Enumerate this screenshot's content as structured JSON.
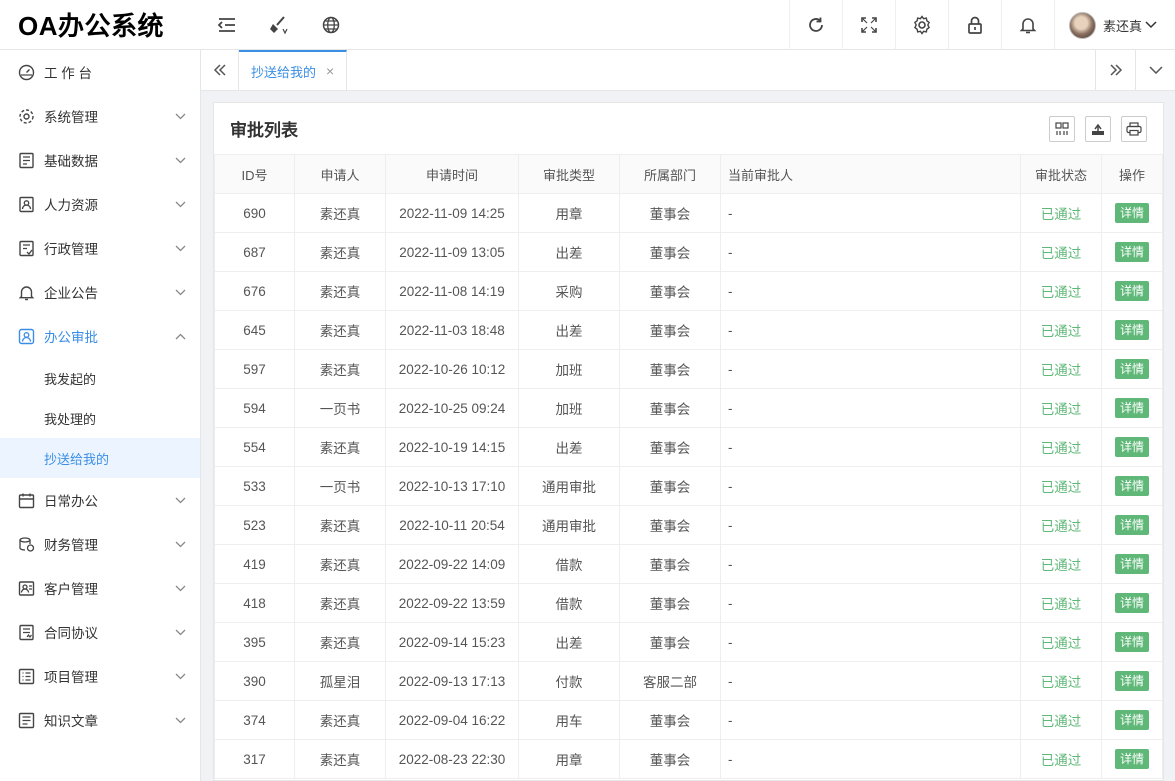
{
  "app": {
    "title": "OA办公系统"
  },
  "topbar": {
    "left_icons": [
      "menu-fold-icon",
      "clear-cache-icon",
      "globe-icon"
    ],
    "right_icons": [
      "refresh-icon",
      "fullscreen-icon",
      "settings-gear-icon",
      "lock-icon",
      "bell-icon"
    ],
    "user_name": "素还真"
  },
  "sidebar": {
    "items": [
      {
        "label": "工 作 台",
        "icon": "dashboard-icon"
      },
      {
        "label": "系统管理",
        "icon": "system-settings-icon"
      },
      {
        "label": "基础数据",
        "icon": "data-icon"
      },
      {
        "label": "人力资源",
        "icon": "hr-icon"
      },
      {
        "label": "行政管理",
        "icon": "admin-icon"
      },
      {
        "label": "企业公告",
        "icon": "bell-outline-icon"
      },
      {
        "label": "办公审批",
        "icon": "approval-icon",
        "open": true
      },
      {
        "label": "日常办公",
        "icon": "calendar-icon"
      },
      {
        "label": "财务管理",
        "icon": "finance-icon"
      },
      {
        "label": "客户管理",
        "icon": "customer-icon"
      },
      {
        "label": "合同协议",
        "icon": "contract-icon"
      },
      {
        "label": "项目管理",
        "icon": "project-icon"
      },
      {
        "label": "知识文章",
        "icon": "article-icon"
      }
    ],
    "submenu": [
      {
        "label": "我发起的"
      },
      {
        "label": "我处理的"
      },
      {
        "label": "抄送给我的",
        "active": true
      }
    ]
  },
  "tabs": {
    "active_label": "抄送给我的",
    "close": "×"
  },
  "card": {
    "title": "审批列表"
  },
  "table": {
    "headers": [
      "ID号",
      "申请人",
      "申请时间",
      "审批类型",
      "所属部门",
      "当前审批人",
      "审批状态",
      "操作"
    ],
    "rows": [
      [
        "690",
        "素还真",
        "2022-11-09 14:25",
        "用章",
        "董事会",
        "-",
        "已通过",
        "详情"
      ],
      [
        "687",
        "素还真",
        "2022-11-09 13:05",
        "出差",
        "董事会",
        "-",
        "已通过",
        "详情"
      ],
      [
        "676",
        "素还真",
        "2022-11-08 14:19",
        "采购",
        "董事会",
        "-",
        "已通过",
        "详情"
      ],
      [
        "645",
        "素还真",
        "2022-11-03 18:48",
        "出差",
        "董事会",
        "-",
        "已通过",
        "详情"
      ],
      [
        "597",
        "素还真",
        "2022-10-26 10:12",
        "加班",
        "董事会",
        "-",
        "已通过",
        "详情"
      ],
      [
        "594",
        "一页书",
        "2022-10-25 09:24",
        "加班",
        "董事会",
        "-",
        "已通过",
        "详情"
      ],
      [
        "554",
        "素还真",
        "2022-10-19 14:15",
        "出差",
        "董事会",
        "-",
        "已通过",
        "详情"
      ],
      [
        "533",
        "一页书",
        "2022-10-13 17:10",
        "通用审批",
        "董事会",
        "-",
        "已通过",
        "详情"
      ],
      [
        "523",
        "素还真",
        "2022-10-11 20:54",
        "通用审批",
        "董事会",
        "-",
        "已通过",
        "详情"
      ],
      [
        "419",
        "素还真",
        "2022-09-22 14:09",
        "借款",
        "董事会",
        "-",
        "已通过",
        "详情"
      ],
      [
        "418",
        "素还真",
        "2022-09-22 13:59",
        "借款",
        "董事会",
        "-",
        "已通过",
        "详情"
      ],
      [
        "395",
        "素还真",
        "2022-09-14 15:23",
        "出差",
        "董事会",
        "-",
        "已通过",
        "详情"
      ],
      [
        "390",
        "孤星泪",
        "2022-09-13 17:13",
        "付款",
        "客服二部",
        "-",
        "已通过",
        "详情"
      ],
      [
        "374",
        "素还真",
        "2022-09-04 16:22",
        "用车",
        "董事会",
        "-",
        "已通过",
        "详情"
      ],
      [
        "317",
        "素还真",
        "2022-08-23 22:30",
        "用章",
        "董事会",
        "-",
        "已通过",
        "详情"
      ]
    ]
  },
  "colors": {
    "accent": "#3a8ee6",
    "success": "#5fb878"
  }
}
